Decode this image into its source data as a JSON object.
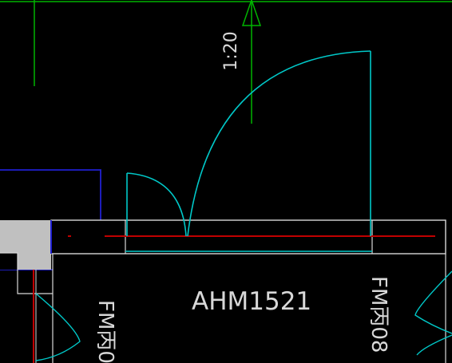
{
  "drawing": {
    "scale_text": "1:20",
    "door_tag": "AHM1521",
    "left_fire_door_tag": "FM丙0",
    "right_fire_door_tag": "FM丙08"
  },
  "colors": {
    "background": "#000000",
    "door_swing": "#00c8c8",
    "axis_line": "#00b400",
    "wall": "#2020d0",
    "red_line": "#c00000",
    "outline": "#d8d8d8",
    "wall_fill": "#c0c0c0",
    "text": "#d8d8d8"
  }
}
